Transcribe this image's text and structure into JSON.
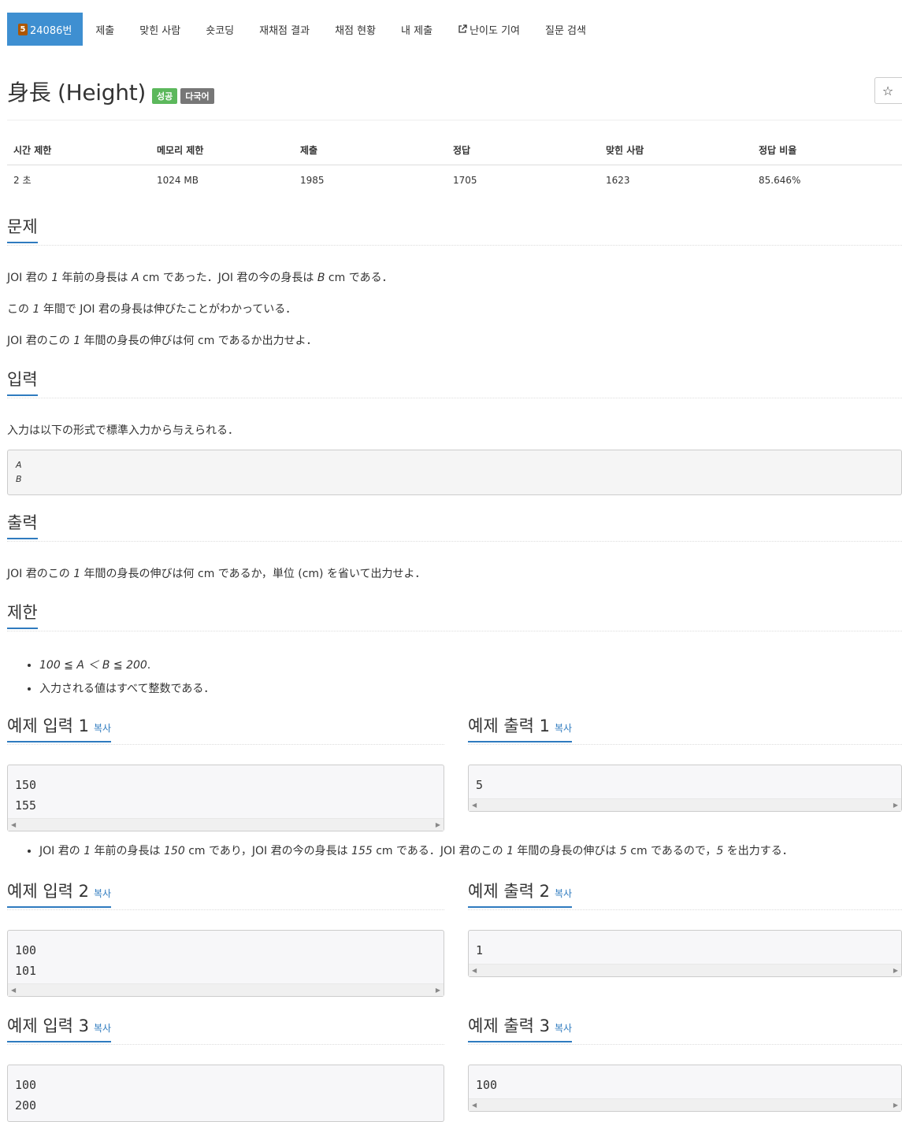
{
  "nav": {
    "problem_id": "24086번",
    "tier": "5",
    "items": [
      "제출",
      "맞힌 사람",
      "숏코딩",
      "재채점 결과",
      "채점 현황",
      "내 제출",
      "난이도 기여",
      "질문 검색"
    ]
  },
  "title": "身長 (Height)",
  "labels": {
    "success": "성공",
    "lang": "다국어"
  },
  "star": "☆",
  "stats": {
    "headers": [
      "시간 제한",
      "메모리 제한",
      "제출",
      "정답",
      "맞힌 사람",
      "정답 비율"
    ],
    "values": [
      "2 초",
      "1024 MB",
      "1985",
      "1705",
      "1623",
      "85.646%"
    ]
  },
  "sections": {
    "problem": "문제",
    "input": "입력",
    "output": "출력",
    "limit": "제한"
  },
  "problem": {
    "p1a": "JOI 君の ",
    "p1b": "1",
    "p1c": " 年前の身長は ",
    "p1d": "A",
    "p1e": " cm であった．JOI 君の今の身長は ",
    "p1f": "B",
    "p1g": " cm である．",
    "p2a": "この ",
    "p2b": "1",
    "p2c": " 年間で JOI 君の身長は伸びたことがわかっている．",
    "p3a": "JOI 君のこの ",
    "p3b": "1",
    "p3c": " 年間の身長の伸びは何 cm であるか出力せよ．"
  },
  "input": {
    "text": "入力は以下の形式で標準入力から与えられる．",
    "format": [
      "A",
      "B"
    ]
  },
  "output": {
    "a": "JOI 君のこの ",
    "b": "1",
    "c": " 年間の身長の伸びは何 cm であるか，単位 (cm) を省いて出力せよ．"
  },
  "limits": {
    "l1": "100 ≦ A ＜ B ≦ 200",
    "l1_end": ".",
    "l2": "入力される値はすべて整数である．"
  },
  "samples": {
    "copy": "복사",
    "in1_title": "예제 입력 1",
    "out1_title": "예제 출력 1",
    "in2_title": "예제 입력 2",
    "out2_title": "예제 출력 2",
    "in3_title": "예제 입력 3",
    "out3_title": "예제 출력 3",
    "in1": "150\n155",
    "out1": "5",
    "in2": "100\n101",
    "out2": "1",
    "in3": "100\n200",
    "out3": "100"
  },
  "note1": {
    "a": "JOI 君の ",
    "b": "1",
    "c": " 年前の身長は ",
    "d": "150",
    "e": " cm であり，JOI 君の今の身長は ",
    "f": "155",
    "g": " cm である．JOI 君のこの ",
    "h": "1",
    "i": " 年間の身長の伸びは ",
    "j": "5",
    "k": " cm であるので，",
    "l": "5",
    "m": " を出力する．"
  }
}
